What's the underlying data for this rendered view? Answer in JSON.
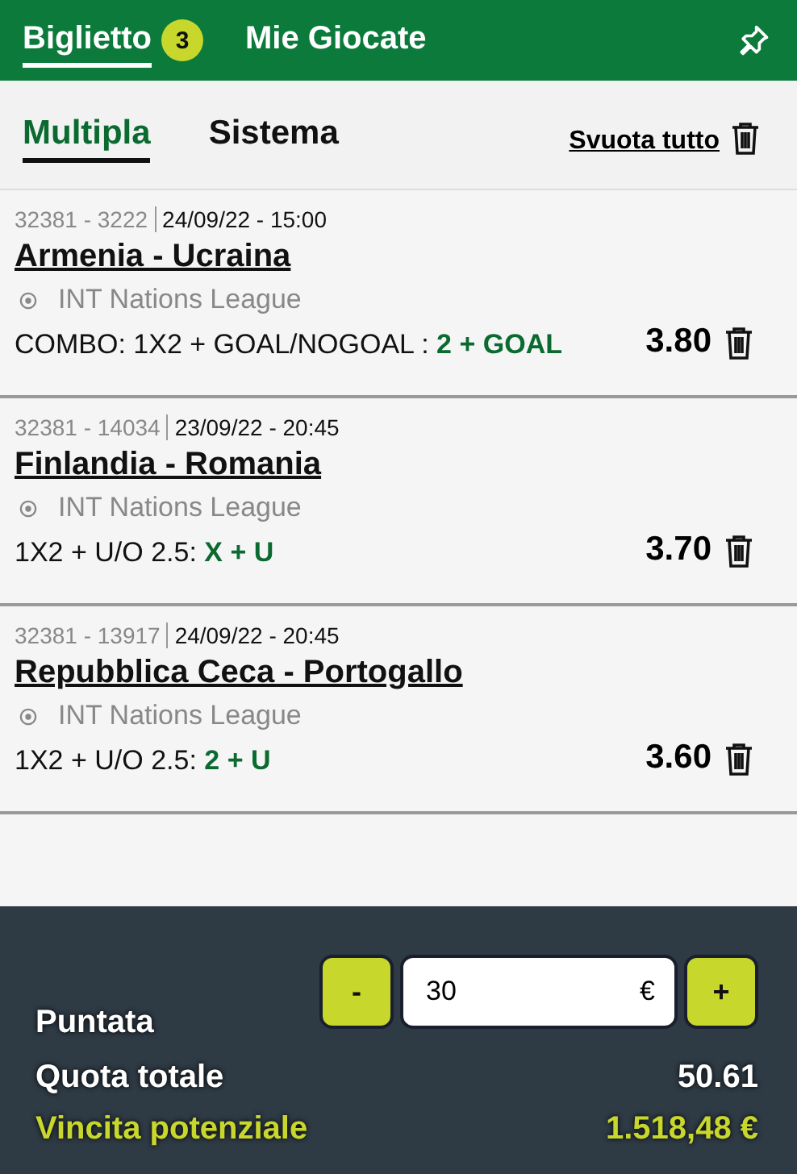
{
  "header": {
    "tabs": [
      {
        "label": "Biglietto",
        "badge": "3",
        "selected": true
      },
      {
        "label": "Mie Giocate",
        "selected": false
      }
    ]
  },
  "bet_types": {
    "tabs": [
      {
        "label": "Multipla",
        "selected": true
      },
      {
        "label": "Sistema",
        "selected": false
      }
    ],
    "clear_all": "Svuota tutto"
  },
  "bets": [
    {
      "code": "32381 - 3222",
      "date": "24/09/22 - 15:00",
      "event": "Armenia - Ucraina",
      "league": "INT Nations League",
      "market": "COMBO: 1X2 + GOAL/NOGOAL : ",
      "pick": "2 + GOAL",
      "odds": "3.80"
    },
    {
      "code": "32381 - 14034",
      "date": "23/09/22 - 20:45",
      "event": "Finlandia - Romania",
      "league": "INT Nations League",
      "market": "1X2 + U/O 2.5: ",
      "pick": "X + U",
      "odds": "3.70"
    },
    {
      "code": "32381 - 13917",
      "date": "24/09/22 - 20:45",
      "event": "Repubblica Ceca - Portogallo",
      "league": "INT Nations League",
      "market": "1X2 + U/O 2.5: ",
      "pick": "2 + U",
      "odds": "3.60"
    }
  ],
  "footer": {
    "stake_label": "Puntata",
    "minus": "-",
    "stake": "30",
    "currency": "€",
    "plus": "+",
    "total_odds_label": "Quota totale",
    "total_odds": "50.61",
    "potential_win_label": "Vincita potenziale",
    "potential_win": "1.518,48 €"
  }
}
